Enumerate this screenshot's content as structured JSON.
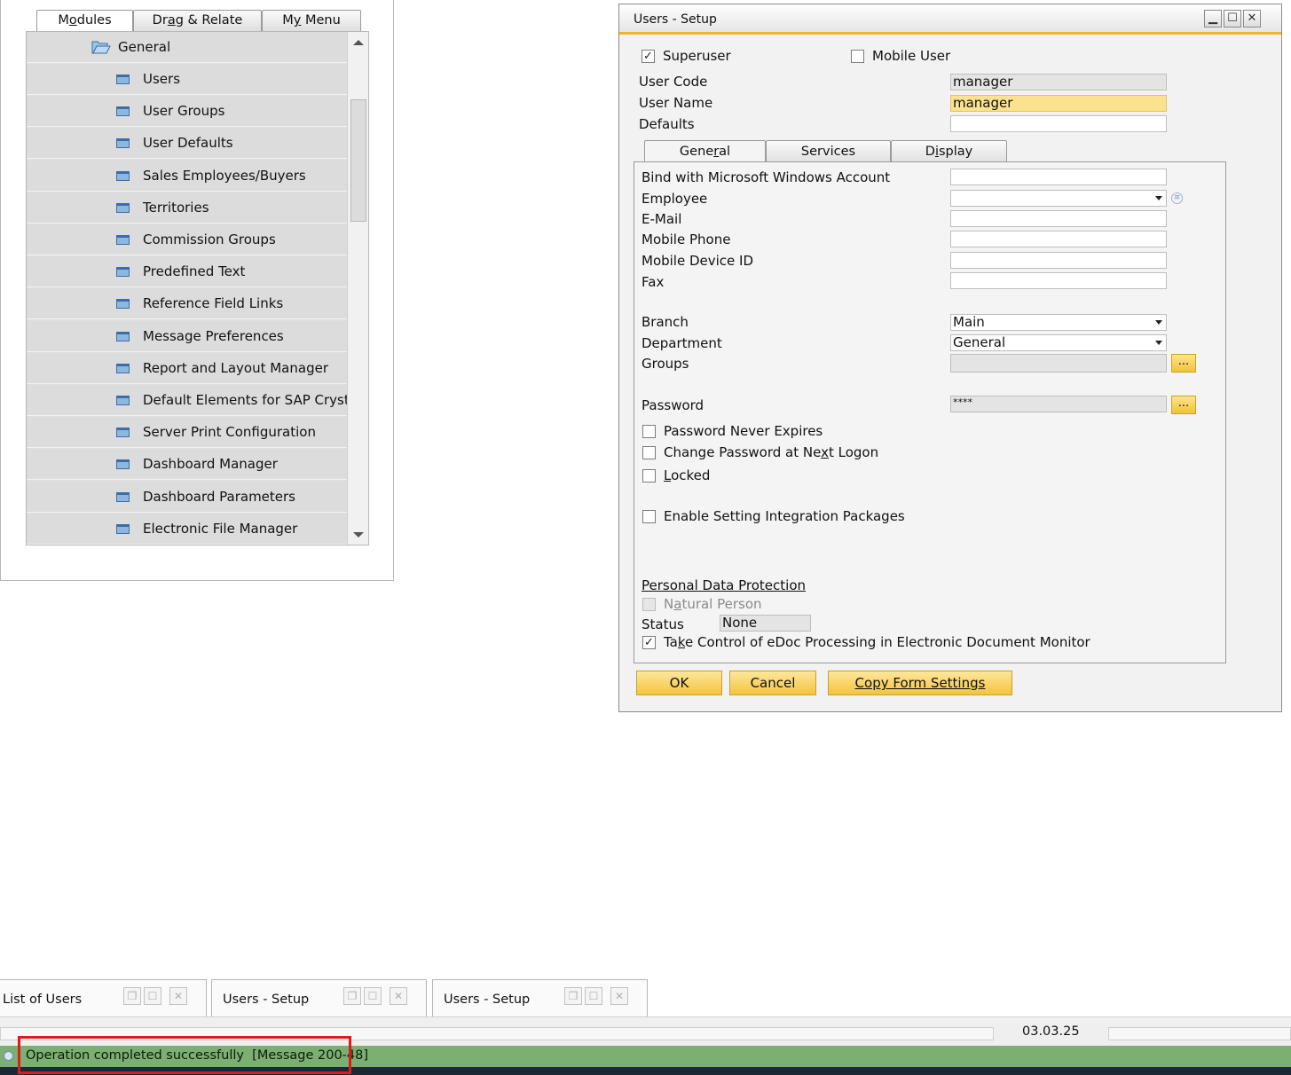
{
  "module_panel": {
    "tabs": [
      "Modules",
      "Drag & Relate",
      "My Menu"
    ],
    "folder": "General",
    "items": [
      "Users",
      "User Groups",
      "User Defaults",
      "Sales Employees/Buyers",
      "Territories",
      "Commission Groups",
      "Predefined Text",
      "Reference Field Links",
      "Message Preferences",
      "Report and Layout Manager",
      "Default Elements for SAP Crysta",
      "Server Print Configuration",
      "Dashboard Manager",
      "Dashboard Parameters",
      "Electronic File Manager"
    ]
  },
  "users_setup": {
    "title": "Users - Setup",
    "superuser_label": "Superuser",
    "superuser_checked": true,
    "mobile_user_label": "Mobile User",
    "mobile_user_checked": false,
    "user_code_label": "User Code",
    "user_code_value": "manager",
    "user_name_label": "User Name",
    "user_name_value": "manager",
    "defaults_label": "Defaults",
    "defaults_value": "",
    "tabs": [
      "General",
      "Services",
      "Display"
    ],
    "active_tab": "General",
    "general": {
      "bind_windows_label": "Bind with Microsoft Windows Account",
      "employee_label": "Employee",
      "email_label": "E-Mail",
      "mobile_phone_label": "Mobile Phone",
      "mobile_device_label": "Mobile Device ID",
      "fax_label": "Fax",
      "branch_label": "Branch",
      "branch_value": "Main",
      "department_label": "Department",
      "department_value": "General",
      "groups_label": "Groups",
      "password_label": "Password",
      "password_value": "****",
      "pw_never_expires_label": "Password Never Expires",
      "change_pw_label": "Change Password at Next Logon",
      "locked_label": "Locked",
      "enable_integration_label": "Enable Setting Integration Packages",
      "personal_data_label": "Personal Data Protection",
      "natural_person_label": "Natural Person",
      "status_label": "Status",
      "status_value": "None",
      "edoc_label": "Take Control of eDoc Processing in Electronic Document Monitor",
      "edoc_checked": true
    },
    "buttons": {
      "ok": "OK",
      "cancel": "Cancel",
      "copy": "Copy Form Settings"
    }
  },
  "taskbar": {
    "windows": [
      "List of Users",
      "Users - Setup",
      "Users - Setup"
    ],
    "date": "03.03.25"
  },
  "status_message": "Operation completed successfully  [Message 200-48]",
  "colors": {
    "accent": "#f0b429",
    "status_bar": "#7bb072",
    "highlight_field": "#fbe28f",
    "annotation_box": "#e01919"
  }
}
